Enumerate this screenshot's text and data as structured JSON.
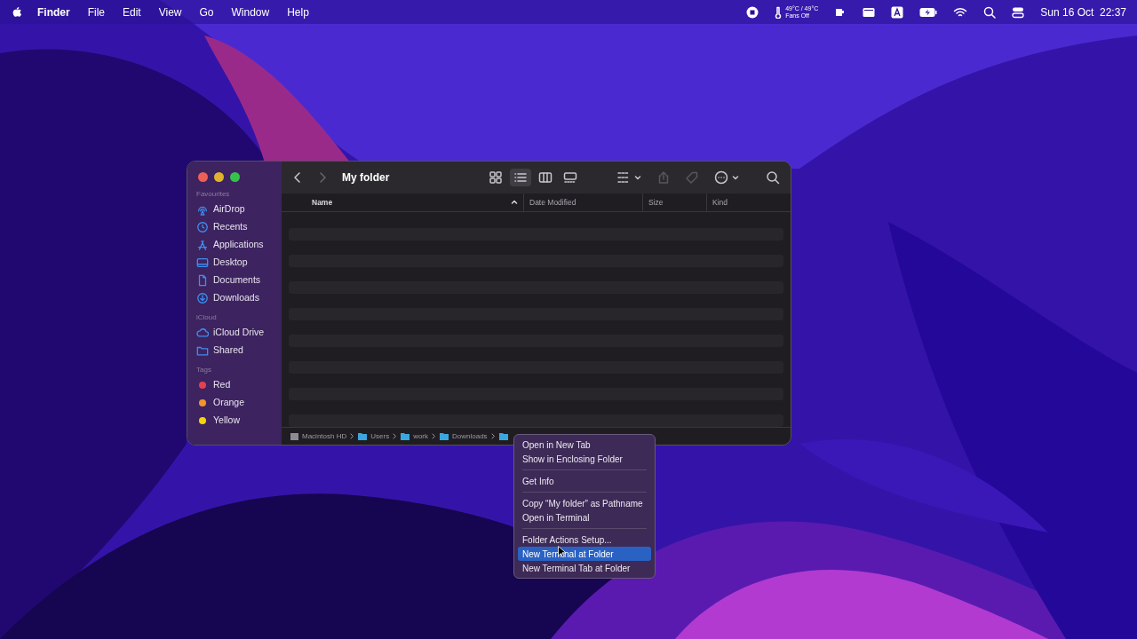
{
  "menu_bar": {
    "app_name": "Finder",
    "menus": [
      "File",
      "Edit",
      "View",
      "Go",
      "Window",
      "Help"
    ],
    "temperature": "49°C / 49°C",
    "fans": "Fans Off",
    "clock": "Sun 16 Oct  22:37"
  },
  "finder": {
    "title": "My folder",
    "sidebar": [
      {
        "heading": "Favourites",
        "items": [
          {
            "label": "AirDrop"
          },
          {
            "label": "Recents"
          },
          {
            "label": "Applications"
          },
          {
            "label": "Desktop"
          },
          {
            "label": "Documents"
          },
          {
            "label": "Downloads"
          }
        ]
      },
      {
        "heading": "iCloud",
        "items": [
          {
            "label": "iCloud Drive"
          },
          {
            "label": "Shared"
          }
        ]
      },
      {
        "heading": "Tags",
        "items": [
          {
            "label": "Red",
            "color": "#e5404f"
          },
          {
            "label": "Orange",
            "color": "#f0962e"
          },
          {
            "label": "Yellow",
            "color": "#f2d40c"
          }
        ]
      }
    ],
    "views": [
      {
        "selected": false
      },
      {
        "selected": true
      },
      {
        "selected": false
      },
      {
        "selected": false
      }
    ],
    "columns": [
      {
        "label": "Name",
        "sorted": true
      },
      {
        "label": "Date Modified",
        "sorted": false
      },
      {
        "label": "Size",
        "sorted": false
      },
      {
        "label": "Kind",
        "sorted": false
      }
    ],
    "path": [
      "Macintosh HD",
      "Users",
      "work",
      "Downloads"
    ]
  },
  "context_menu": {
    "groups": [
      [
        {
          "label": "Open in New Tab",
          "selected": false
        },
        {
          "label": "Show in Enclosing Folder",
          "selected": false
        }
      ],
      [
        {
          "label": "Get Info",
          "selected": false
        }
      ],
      [
        {
          "label": "Copy “My folder” as Pathname",
          "selected": false
        },
        {
          "label": "Open in Terminal",
          "selected": false
        }
      ],
      [
        {
          "label": "Folder Actions Setup...",
          "selected": false
        },
        {
          "label": "New Terminal at Folder",
          "selected": true
        },
        {
          "label": "New Terminal Tab at Folder",
          "selected": false
        }
      ]
    ]
  }
}
